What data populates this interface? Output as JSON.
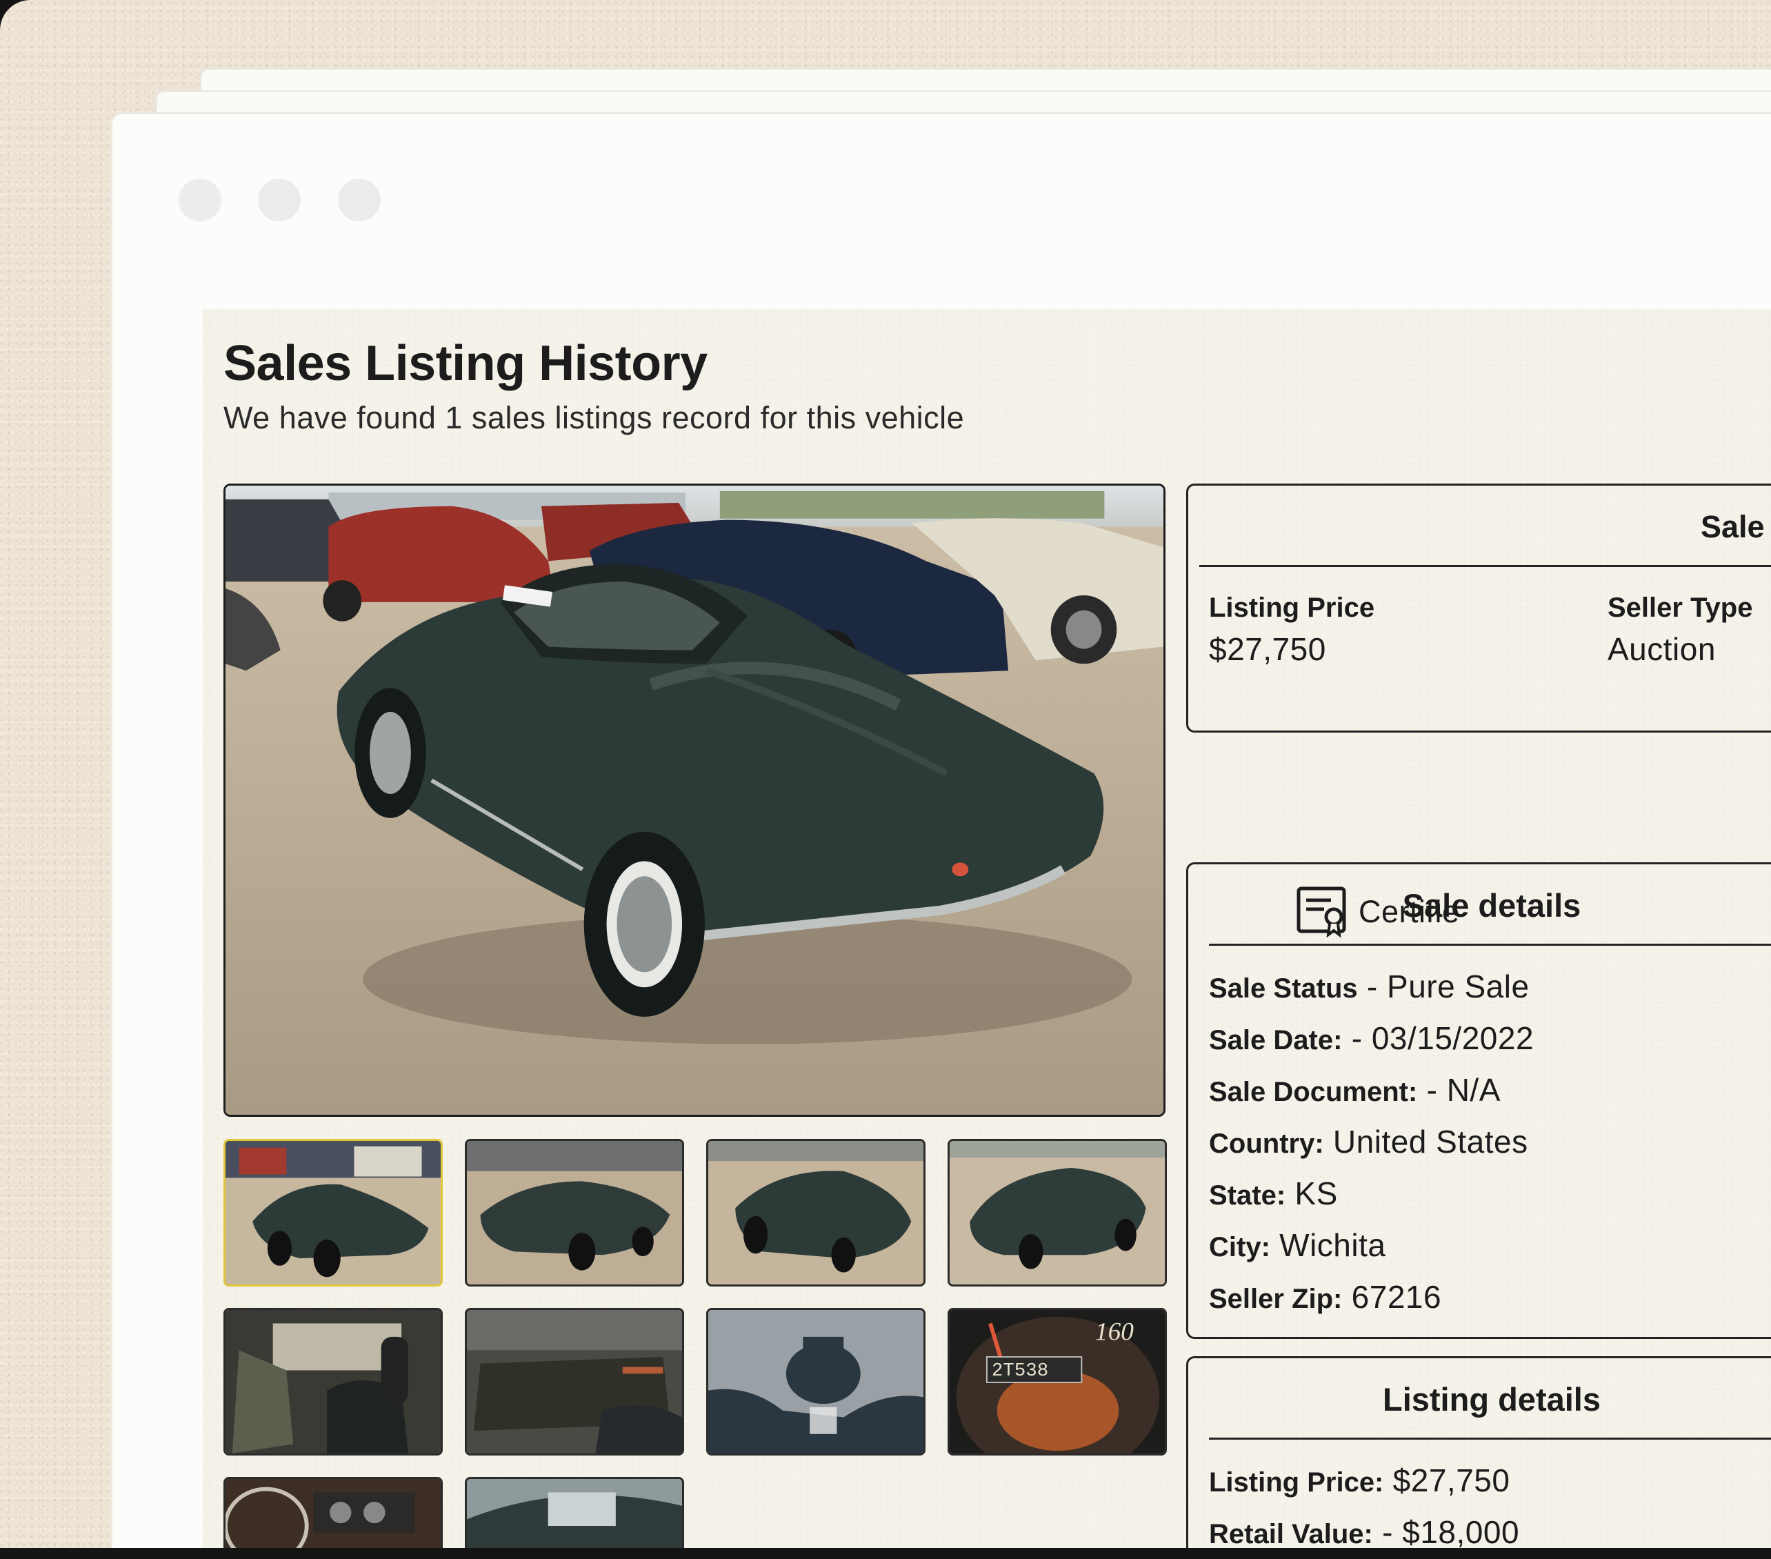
{
  "page": {
    "title": "Sales Listing History",
    "subtitle": "We have found 1 sales listings record for this vehicle"
  },
  "summary_card": {
    "heading": "Sale",
    "listing_price_label": "Listing Price",
    "listing_price_value": "$27,750",
    "seller_type_label": "Seller Type",
    "seller_type_value": "Auction"
  },
  "certificate": {
    "label": "Certifie",
    "icon": "certificate-icon"
  },
  "sale_details": {
    "heading": "Sale details",
    "rows": [
      {
        "label": "Sale Status",
        "sep": " - ",
        "value": "Pure Sale"
      },
      {
        "label": "Sale Date:",
        "sep": " - ",
        "value": "03/15/2022"
      },
      {
        "label": "Sale Document:",
        "sep": " - ",
        "value": "N/A"
      },
      {
        "label": "Country:",
        "sep": " ",
        "value": "United States"
      },
      {
        "label": "State:",
        "sep": " ",
        "value": "KS"
      },
      {
        "label": "City:",
        "sep": " ",
        "value": "Wichita"
      },
      {
        "label": "Seller Zip:",
        "sep": " ",
        "value": "67216"
      }
    ]
  },
  "listing_details": {
    "heading": "Listing details",
    "rows": [
      {
        "label": "Listing Price:",
        "sep": " ",
        "value": "$27,750"
      },
      {
        "label": "Retail Value:",
        "sep": " - ",
        "value": "$18,000"
      }
    ]
  },
  "gallery": {
    "thumbnails": [
      "front-left-exterior",
      "front-right-exterior",
      "rear-left-exterior",
      "rear-right-exterior",
      "interior-driver",
      "interior-floor",
      "hood-emblem",
      "odometer",
      "dashboard",
      "windshield-interior"
    ],
    "odometer_text": "2T538",
    "speedo_number": "160"
  },
  "colors": {
    "accent_thumb_border": "#e1c73a",
    "card_border": "#222222",
    "car_body": "#2c3a38"
  }
}
